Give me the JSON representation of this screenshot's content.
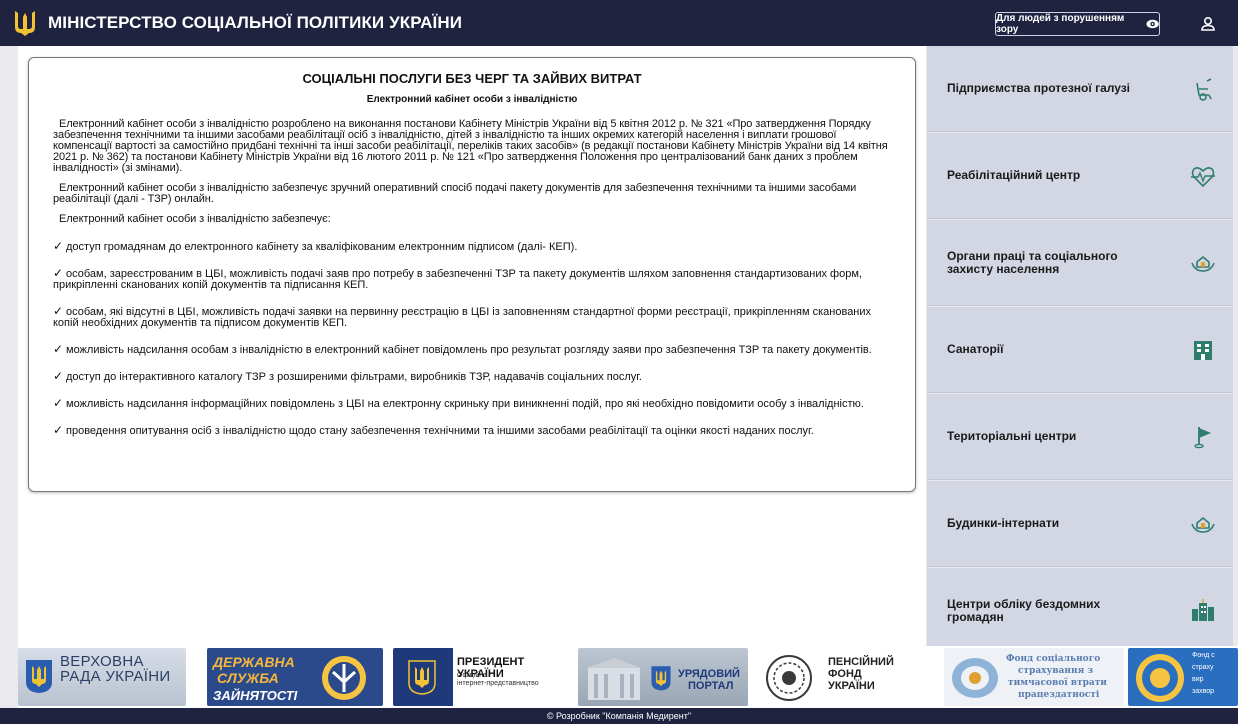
{
  "header": {
    "title": "МІНІСТЕРСТВО СОЦІАЛЬНОЇ ПОЛІТИКИ УКРАЇНИ",
    "vision_button": "Для людей з порушенням зору",
    "icons": [
      "trident-icon",
      "eye-icon",
      "user-icon"
    ]
  },
  "article": {
    "heading": "СОЦІАЛЬНІ ПОСЛУГИ БЕЗ ЧЕРГ ТА ЗАЙВИХ ВИТРАТ",
    "subheading": "Електронний кабінет особи з інвалідністю",
    "paragraphs": [
      "Електронний кабінет особи з інвалідністю розроблено на виконання постанови Кабінету Міністрів України від 5 квітня 2012 р. № 321 «Про затвердження Порядку забезпечення технічними та іншими засобами реабілітації осіб з інвалідністю, дітей з інвалідністю та інших окремих категорій населення і виплати грошової компенсації вартості за самостійно придбані технічні та інші засоби реабілітації, переліків таких засобів» (в редакції постанови Кабінету Міністрів України від 14 квітня 2021 р. № 362) та постанови Кабінету Міністрів України від 16 лютого 2011 р. № 121 «Про затвердження Положення про централізований банк даних з проблем інвалідності» (зі змінами).",
      "Електронний кабінет особи з інвалідністю забезпечує зручний оперативний спосіб подачі пакету документів для забезпечення технічними та іншими засобами реабілітації (далі - ТЗР) онлайн.",
      "Електронний кабінет особи з інвалідністю забезпечує:"
    ],
    "bullets": [
      "доступ громадянам до електронного кабінету за кваліфікованим електронним підписом (далі- КЕП).",
      "особам, зареєстрованим в ЦБІ, можливість подачі заяв про потребу в забезпеченні ТЗР та пакету документів шляхом заповнення стандартизованих форм, прикріпленні сканованих копій документів та підписання КЕП.",
      "особам, які відсутні в ЦБІ, можливість подачі заявки на первинну реєстрацію в ЦБІ із заповненням стандартної форми реєстрації, прикріпленням сканованих копій необхідних документів та підписом документів КЕП.",
      "можливість надсилання особам з інвалідністю в електронний кабінет повідомлень про результат розгляду заяви про забезпечення ТЗР та пакету документів.",
      "доступ до інтерактивного каталогу ТЗР з розширеними фільтрами, виробників ТЗР, надавачів соціальних послуг.",
      "можливість надсилання інформаційних повідомлень з ЦБІ на електронну скриньку при виникненні подій, про які необхідно повідомити особу з інвалідністю.",
      "проведення опитування осіб з інвалідністю щодо стану забезпечення технічними та іншими засобами реабілітації та оцінки якості наданих послуг."
    ],
    "check_mark": "✓"
  },
  "sidebar": {
    "items": [
      {
        "label": "Підприємства протезної галузі",
        "icon": "wheelchair-icon"
      },
      {
        "label": "Реабілітаційний центр",
        "icon": "heart-pulse-icon"
      },
      {
        "label": "Органи праці та соціального захисту населення",
        "icon": "house-hands-icon"
      },
      {
        "label": "Санаторії",
        "icon": "building-icon"
      },
      {
        "label": "Територіальні центри",
        "icon": "flag-icon"
      },
      {
        "label": "Будинки-інтернати",
        "icon": "house-hands-icon"
      },
      {
        "label": "Центри обліку бездомних громадян",
        "icon": "city-icon"
      }
    ]
  },
  "logos": {
    "rada": "ВЕРХОВНА РАДА УКРАЇНИ",
    "employment_line1": "ДЕРЖАВНА",
    "employment_line2": "СЛУЖБА",
    "employment_line3": "ЗАЙНЯТОСТІ",
    "president_line1": "ПРЕЗИДЕНТ УКРАЇНИ",
    "president_line2": "Офіційне",
    "president_line3": "інтернет-представництво",
    "gov_line1": "УРЯДОВИЙ",
    "gov_line2": "ПОРТАЛ",
    "pension_line1": "ПЕНСІЙНИЙ",
    "pension_line2": "ФОНД",
    "pension_line3": "УКРАЇНИ",
    "fund_line1": "Фонд соціального",
    "fund_line2": "страхування з",
    "fund_line3": "тимчасової втрати",
    "fund_line4": "працездатності",
    "last_line1": "Фонд с",
    "last_line2": "страху",
    "last_line3": "вир",
    "last_line4": "захвор"
  },
  "footer": {
    "text": "© Розробник \"Компанія Медирент\""
  }
}
